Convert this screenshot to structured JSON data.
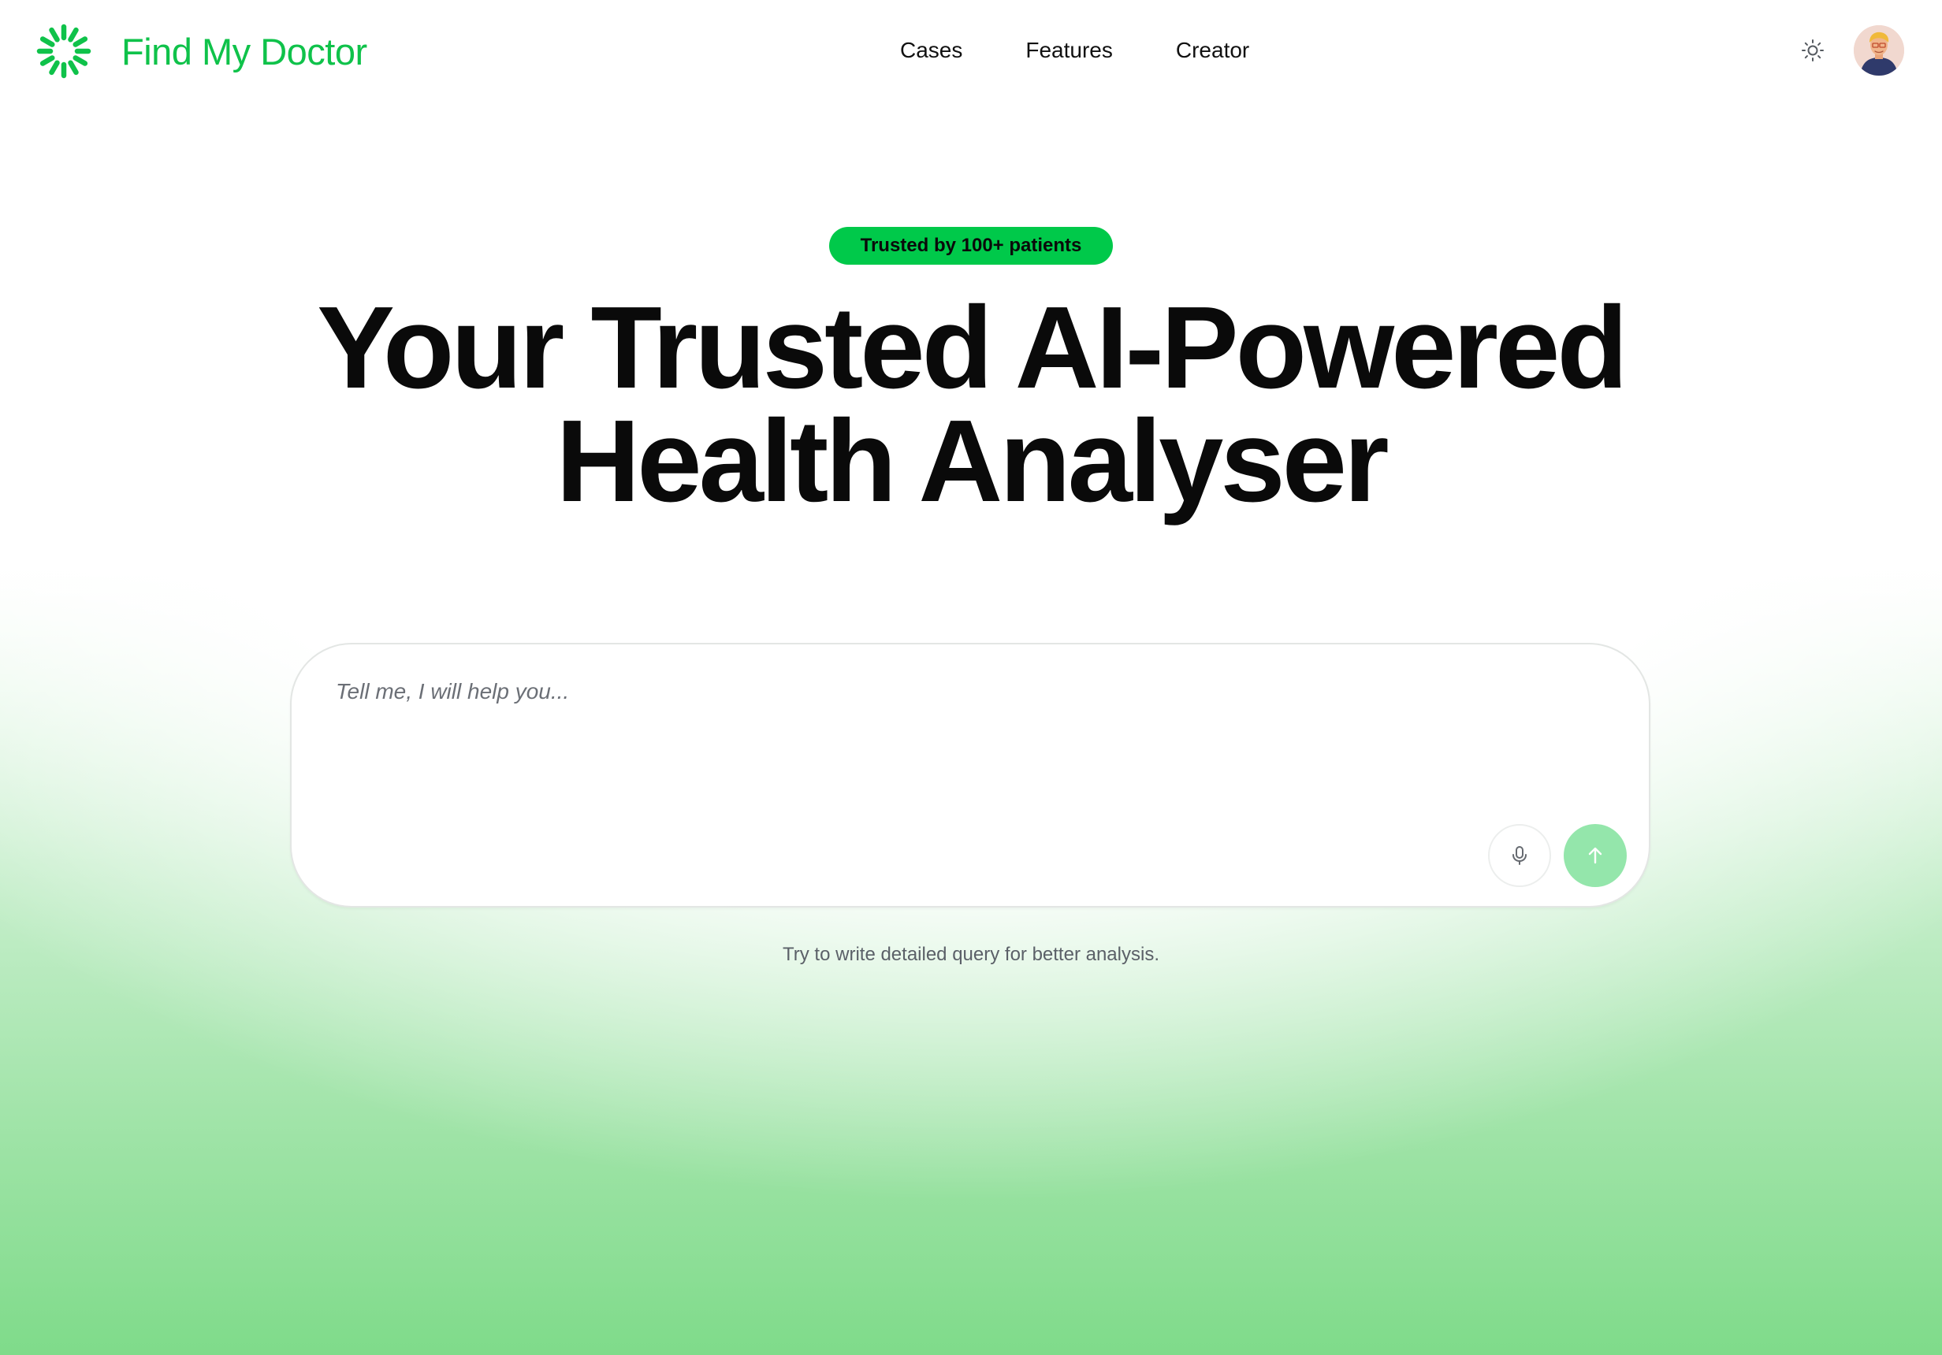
{
  "brand": {
    "name": "Find My Doctor",
    "logo_icon": "sunburst-logo-icon",
    "accent_color": "#0fc24a"
  },
  "nav": {
    "items": [
      {
        "label": "Cases"
      },
      {
        "label": "Features"
      },
      {
        "label": "Creator"
      }
    ]
  },
  "header": {
    "theme_toggle_icon": "sun-icon",
    "avatar_icon": "user-avatar"
  },
  "hero": {
    "badge": "Trusted by 100+ patients",
    "badge_color": "#00c94a",
    "title_line1": "Your Trusted AI-Powered",
    "title_line2": "Health Analyser"
  },
  "query": {
    "placeholder": "Tell me, I will help you...",
    "value": "",
    "mic_icon": "microphone-icon",
    "send_icon": "arrow-up-icon",
    "send_color": "#94e6ab",
    "hint": "Try to write detailed query for better analysis."
  }
}
